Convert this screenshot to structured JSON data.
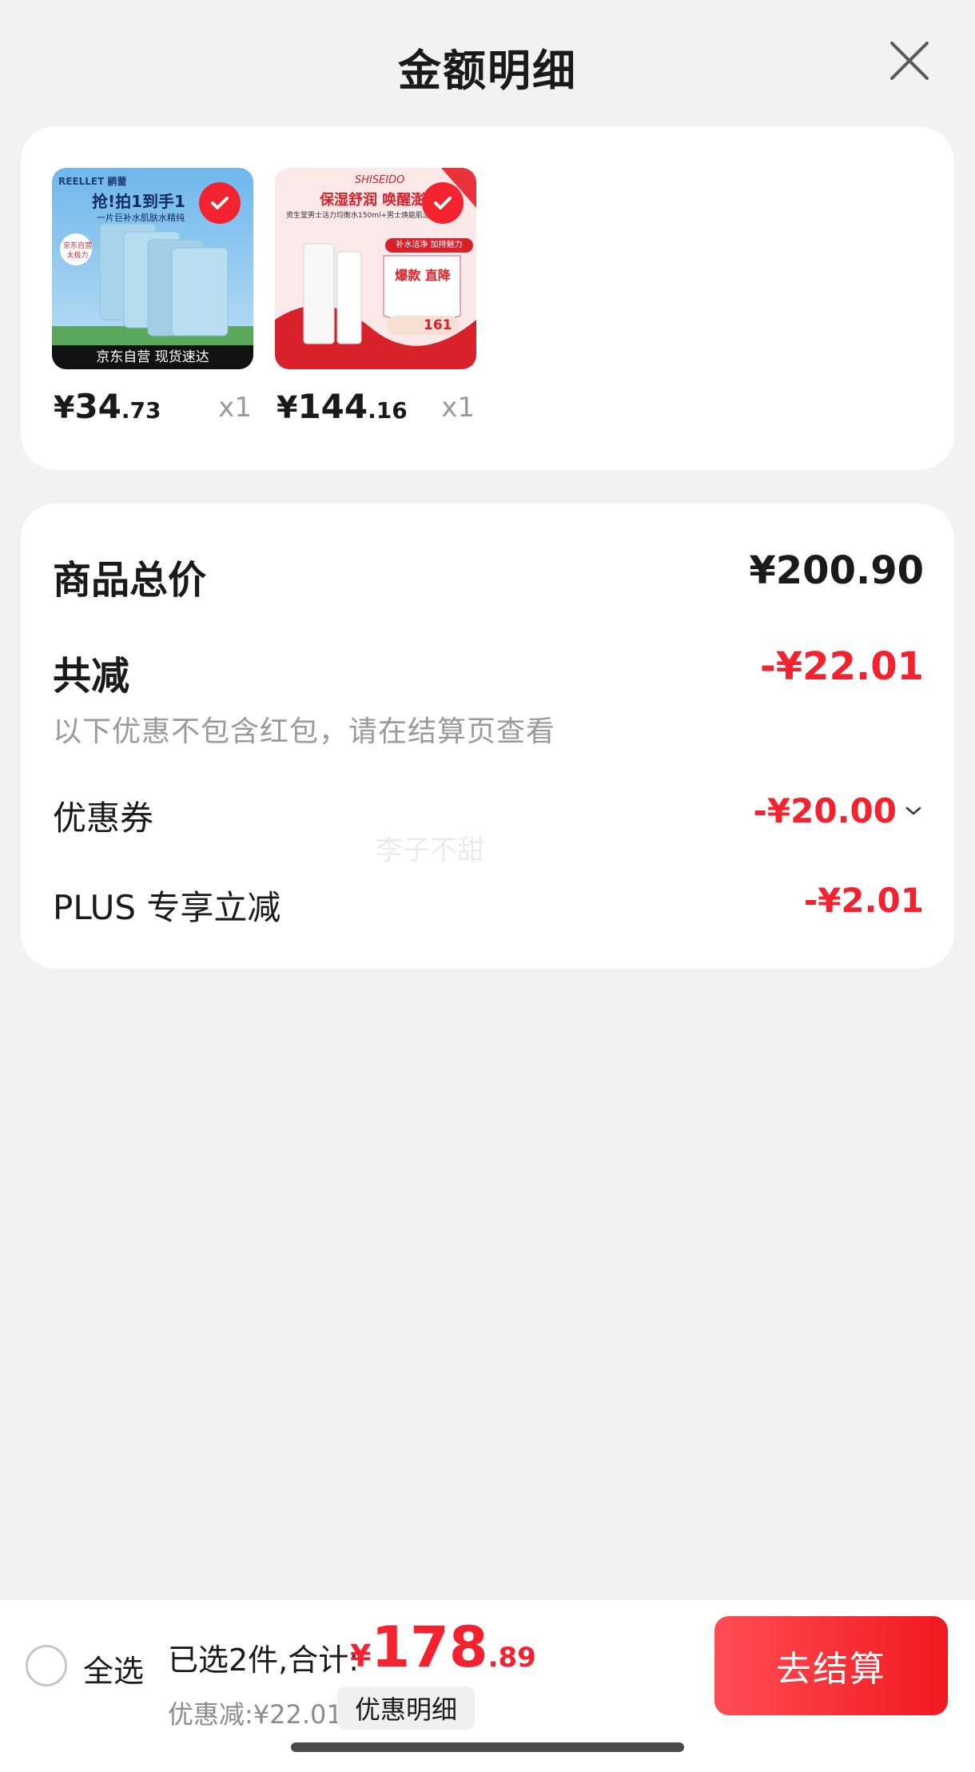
{
  "header": {
    "title": "金额明细"
  },
  "products": [
    {
      "banner_brand": "REELLET 鹂蕾",
      "banner_headline": "抢!拍1到手1",
      "banner_sub": "一片巨补水肌肤水精纯",
      "banner_sticker": "京东自营 太极力",
      "banner_footer": "京东自营 现货速达",
      "price_currency": "¥",
      "price_int": "34",
      "price_dec": ".73",
      "qty": "x1"
    },
    {
      "banner_brand": "SHISEIDO",
      "banner_headline": "保湿舒润 唤醒澎湃活",
      "banner_sub": "资生堂男士活力均衡水150ml+男士焕能肌活",
      "banner_tag": "补水洁净 加持魅力",
      "banner_stamp": "爆款 直降",
      "banner_final": "161",
      "price_currency": "¥",
      "price_int": "144",
      "price_dec": ".16",
      "qty": "x1"
    }
  ],
  "summary": {
    "total_label": "商品总价",
    "total_value": "¥200.90",
    "discount_label": "共减",
    "discount_value": "-¥22.01",
    "discount_note": "以下优惠不包含红包，请在结算页查看",
    "coupon_label": "优惠券",
    "coupon_value": "-¥20.00",
    "plus_label": "PLUS 专享立减",
    "plus_value": "-¥2.01",
    "watermark": "李子不甜"
  },
  "bottom_bar": {
    "select_all": "全选",
    "selected_info": "已选2件,合计:",
    "total_currency": "¥",
    "total_int": "178",
    "total_dec": ".89",
    "discount_line": "优惠减:¥22.01",
    "detail_button": "优惠明细",
    "checkout_button": "去结算"
  },
  "colors": {
    "accent_red": "#f2232f",
    "background": "#f2f2f2",
    "card": "#ffffff"
  },
  "icons": {
    "close": "close-icon",
    "check": "check-circle-icon",
    "chevron": "chevron-down-icon",
    "radio": "radio-unchecked-icon"
  }
}
